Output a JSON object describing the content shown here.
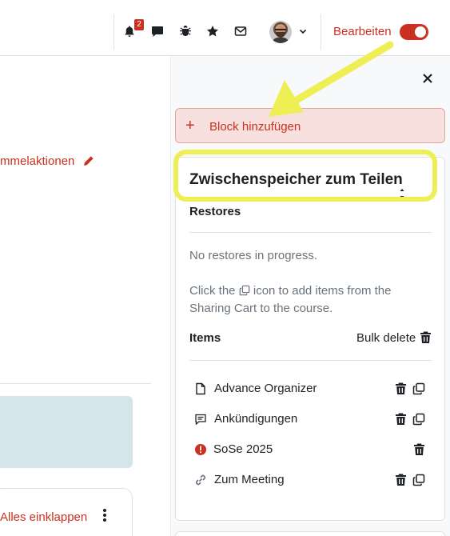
{
  "navbar": {
    "notification_count": "2",
    "edit_label": "Bearbeiten",
    "edit_mode_on": true,
    "accent_color": "#ca3120",
    "icons": [
      "bell-icon",
      "chat-icon",
      "bug-icon",
      "star-icon",
      "mail-icon",
      "chevron-down-icon"
    ]
  },
  "main": {
    "bulk_actions_label": "mmelaktionen",
    "collapse_all_label": "Alles einklappen"
  },
  "drawer": {
    "add_block_label": "Block hinzufügen",
    "block": {
      "title": "Zwischenspeicher zum Teilen",
      "restores_heading": "Restores",
      "no_restores_text": "No restores in progress.",
      "help_before": "Click the",
      "help_after": "icon to add items from the Sharing Cart to the course.",
      "items_heading": "Items",
      "bulk_delete_label": "Bulk delete",
      "items": [
        {
          "label": "Advance Organizer",
          "icon": "file-icon",
          "deletable": true,
          "copyable": true
        },
        {
          "label": "Ankündigungen",
          "icon": "forum-icon",
          "deletable": true,
          "copyable": true
        },
        {
          "label": "SoSe 2025",
          "icon": "error-icon",
          "deletable": true,
          "copyable": false
        },
        {
          "label": "Zum Meeting",
          "icon": "link-icon",
          "deletable": true,
          "copyable": true
        }
      ]
    }
  },
  "annotation": {
    "highlight_color": "#eeee55"
  }
}
